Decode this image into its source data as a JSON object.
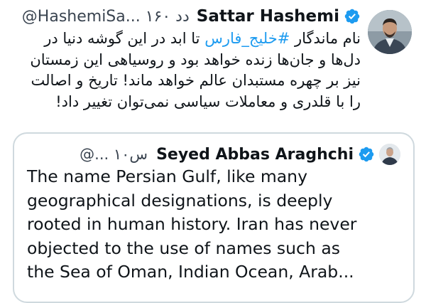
{
  "tweet": {
    "author_name": "Sattar Hashemi",
    "handle_time": "@HashemiSa... ۱۶۰ دد",
    "lines": [
      "نام ماندگار #خلیج_فارس تا ابد در این گوشه دنیا در",
      "دل‌ها و جان‌ها زنده خواهد بود و روسیاهی این زمستان",
      "نیز بر چهره مستبدان عالم خواهد ماند! تاریخ و اصالت",
      "را با قلدری و معاملات سیاسی نمی‌توان تغییر داد!"
    ],
    "line1_before": "نام ماندگار ",
    "line1_hashtag": "#خلیج_فارس",
    "line1_after": " تا ابد در این گوشه دنیا در"
  },
  "quote": {
    "author_name": "Seyed Abbas Araghchi",
    "handle_time": "@... ۱۰س",
    "lines": [
      "The name Persian Gulf, like many",
      "geographical designations, is deeply",
      "rooted in human history. Iran has never",
      "objected to the use of names such as",
      "the Sea of Oman, Indian Ocean, Arab..."
    ]
  },
  "colors": {
    "verified": "#1d9bf0",
    "hashtag": "#1d9bf0",
    "border": "#cfd9de"
  }
}
